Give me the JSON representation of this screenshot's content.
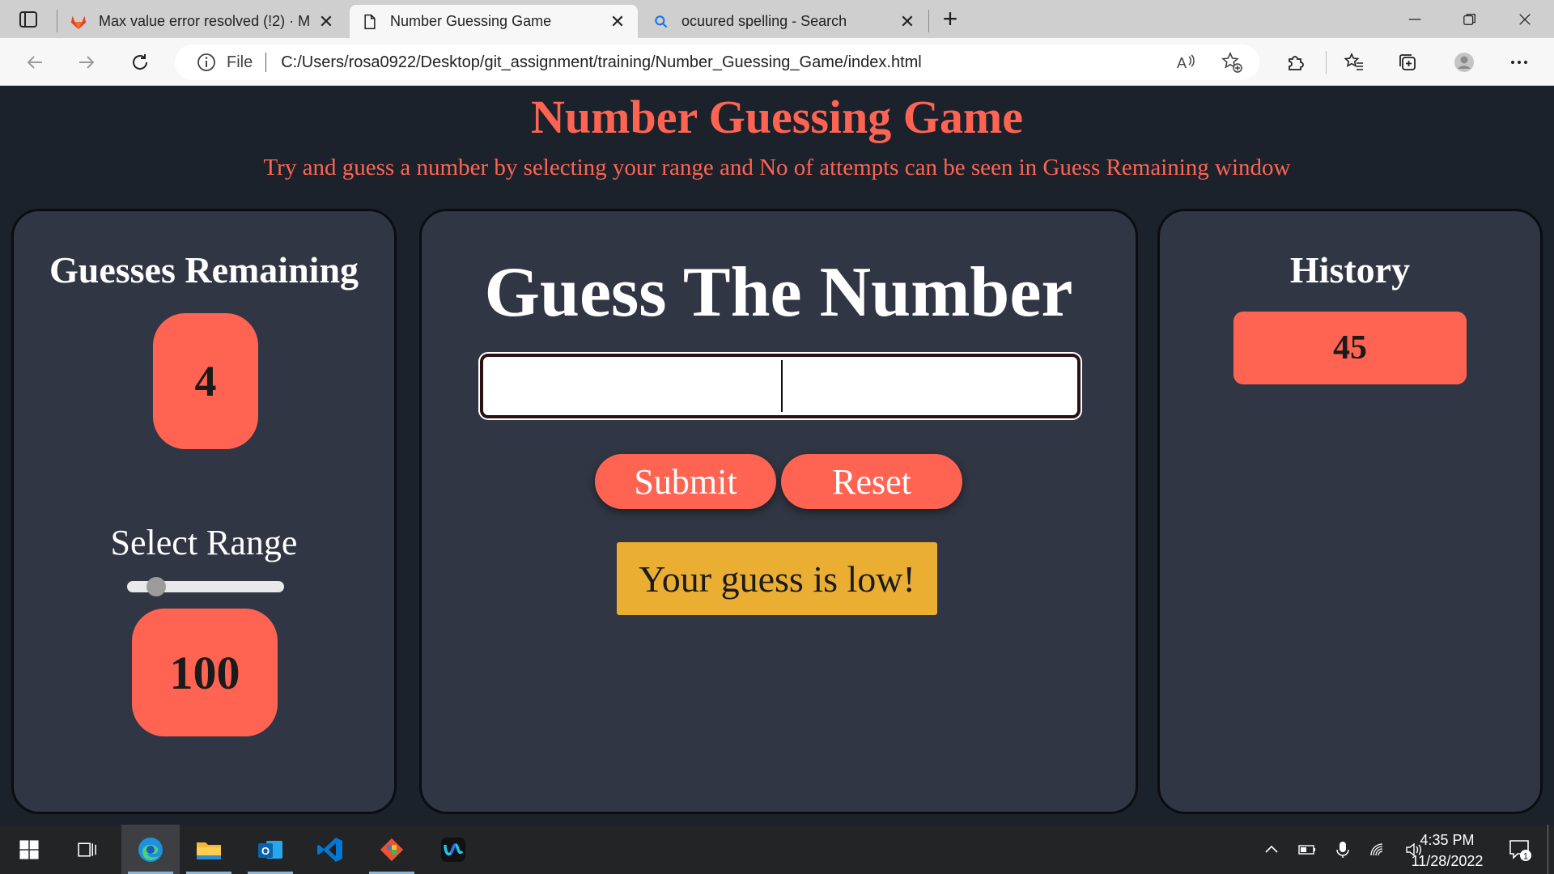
{
  "browser": {
    "tabs": [
      {
        "title": "Max value error resolved (!2) · M",
        "favicon": "gitlab-icon",
        "active": false
      },
      {
        "title": "Number Guessing Game",
        "favicon": "document-icon",
        "active": true
      },
      {
        "title": "ocuured spelling - Search",
        "favicon": "search-icon",
        "active": false
      }
    ],
    "address": {
      "scheme_label": "File",
      "url": "C:/Users/rosa0922/Desktop/git_assignment/training/Number_Guessing_Game/index.html"
    }
  },
  "page": {
    "title": "Number Guessing Game",
    "subtitle": "Try and guess a number by selecting your range and No of attempts can be seen in Guess Remaining window"
  },
  "left_panel": {
    "guesses_label": "Guesses Remaining",
    "guesses_remaining": "4",
    "range_label": "Select Range",
    "range_value": "100",
    "slider_fraction": 0.14
  },
  "center_panel": {
    "heading": "Guess The Number",
    "input_value": "",
    "submit_label": "Submit",
    "reset_label": "Reset",
    "feedback": "Your guess is low!"
  },
  "right_panel": {
    "history_label": "History",
    "history": [
      "45"
    ]
  },
  "taskbar": {
    "apps": [
      "windows-start-icon",
      "task-view-icon",
      "edge-icon",
      "file-explorer-icon",
      "outlook-icon",
      "vscode-icon",
      "git-icon",
      "webex-icon"
    ],
    "time": "4:35 PM",
    "date": "11/28/2022",
    "notification_count": "1"
  },
  "colors": {
    "accent": "#ff6452",
    "panel": "#303643",
    "background": "#1b222c",
    "feedback": "#eaae33"
  }
}
